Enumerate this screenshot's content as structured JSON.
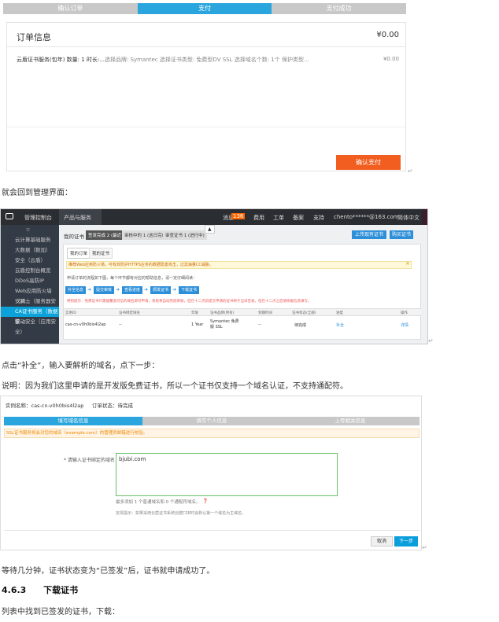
{
  "step1": {
    "s1": "确认订单",
    "s2": "支付",
    "s3": "支付成功"
  },
  "order": {
    "title": "订单信息",
    "total": "¥0.00",
    "item": "云盾证书服务(包年) 数量: 1 时长:...",
    "desc": "选择品牌: Symantec 选择证书类型: 免费型DV SSL 选择域名个数: 1个 保护类型...",
    "price": "¥0.00",
    "pay": "确认支付"
  },
  "text1": "就会回到管理界面：",
  "console": {
    "logo": "管理控制台",
    "menu": "产品与服务",
    "msg": "消息",
    "msgc": "136",
    "fee": "费用",
    "work": "工单",
    "record": "备案",
    "support": "支持",
    "user": "chento******@163.com",
    "lang": "简体中文",
    "side": [
      "云计算基础服务",
      "大数据（数加）",
      "安全（云盾）",
      "云盾控制台概览",
      "DDoS高防IP",
      "Web应用防火墙（网...",
      "安骑士（服务器安全）",
      "CA证书服务（数据安...",
      "移动安全（应用安全）"
    ],
    "tab1": "我的证书",
    "tab2": "签发完成 2 (最近)",
    "tab3": "审核中的 1 (这日完成)",
    "tab4": "审查证书 1 (进行中)",
    "btnUp": "上传现有证书",
    "btnBuy": "购买证书",
    "sub1": "我的订单",
    "sub2": "我的证书",
    "notice": "推荐Web应用防火墙，可有效防护HTTPS业务的数据隐患攻击，过滤海量CC威胁。",
    "flowtxt": "申请订单的流程如下图，每个环节都有对应的帮助信息，请一定仔细阅读：",
    "flow": [
      "补全信息",
      "提交审核",
      "查看进度",
      "颁发证书",
      "下载证书"
    ],
    "warn": "特别提示：免费证书只需能覆盖可信的域名即可申请，系统将自动完成审核，但在十二点前提交申请的证书将于当日签发，但在十二点之后请依据信息填写。",
    "cols": [
      "实例ID",
      "证书绑定域名",
      "年限",
      "证书品牌(所有)",
      "到期时间",
      "证书状态(全部)",
      "进度",
      "操作"
    ],
    "row": [
      "cas-cn-v0h0bis4l2ap",
      "--",
      "1 Year",
      "Symantec 免费版 SSL",
      "--",
      "待完成",
      "补全",
      "详情"
    ]
  },
  "text2": "点击“补全”，输入要解析的域名，点下一步：",
  "text3": "说明：因为我们这里申请的是开发版免费证书，所以一个证书仅支持一个域名认证，不支持通配符。",
  "form": {
    "inst": "实例名称：cas-cn-v0h0bis4l2ap",
    "status": "订单状态：待完成",
    "s1": "填写域名信息",
    "s2": "填写个人信息",
    "s3": "上传相关信息",
    "tip": "SSL证书服务将会对您的域名（example.com）的管理员邮箱进行校验。",
    "label": "* 请输入证书绑定的域名：",
    "value": "bjubi.com",
    "note1": "最多添加 1 个普通域名和 0 个通配符域名。",
    "note2": "友情提示：如果采用云盾证书系统创建CSR时会默认第一个域名为主域名。",
    "cancel": "取消",
    "next": "下一步"
  },
  "text4": "等待几分钟，证书状态变为“已签发”后，证书就申请成功了。",
  "heading": {
    "num": "4.6.3",
    "title": "下载证书"
  },
  "text5": "列表中找到已签发的证书，下载："
}
